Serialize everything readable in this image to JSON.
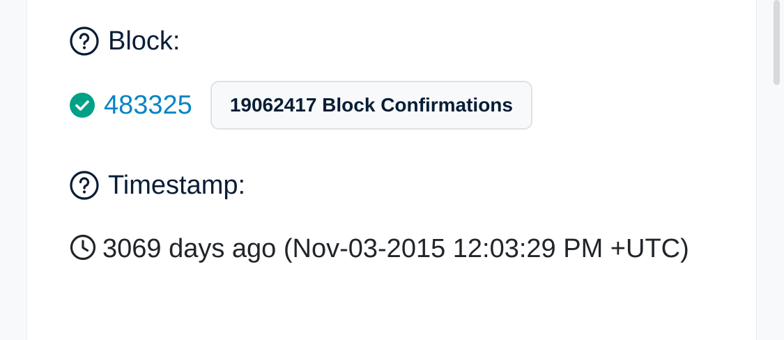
{
  "block": {
    "heading": "Block:",
    "number": "483325",
    "confirmations": "19062417 Block Confirmations"
  },
  "timestamp": {
    "heading": "Timestamp:",
    "value": "3069 days ago (Nov-03-2015 12:03:29 PM +UTC)"
  },
  "icons": {
    "help": "question-circle-icon",
    "status": "check-circle-icon",
    "time": "clock-icon"
  },
  "colors": {
    "heading": "#081d35",
    "link": "#0784c3",
    "success": "#00a186"
  }
}
